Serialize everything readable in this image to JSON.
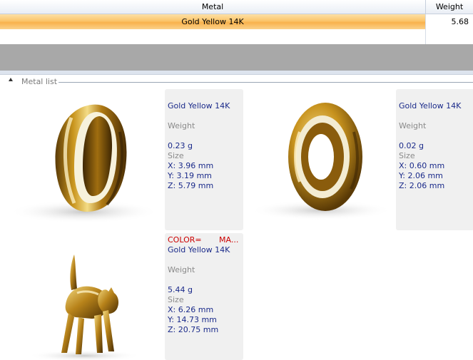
{
  "grid": {
    "headers": {
      "metal": "Metal",
      "weight": "Weight"
    },
    "rows": [
      {
        "metal": "Gold Yellow 14K",
        "weight": "5.68"
      }
    ]
  },
  "metal_list": {
    "title": "Metal list",
    "items": [
      {
        "color_label": "",
        "color_value": "",
        "metal": "Gold Yellow 14K",
        "weight_label": "Weight",
        "weight": "0.23 g",
        "size_label": "Size",
        "x": "X: 3.96 mm",
        "y": "Y: 3.19 mm",
        "z": "Z: 5.79 mm",
        "thumbnail": "teardrop-ring"
      },
      {
        "color_label": "",
        "color_value": "",
        "metal": "Gold Yellow 14K",
        "weight_label": "Weight",
        "weight": "0.02 g",
        "size_label": "Size",
        "x": "X: 0.60 mm",
        "y": "Y: 2.06 mm",
        "z": "Z: 2.06 mm",
        "thumbnail": "round-ring"
      },
      {
        "color_label": "COLOR=",
        "color_value": "MA...",
        "metal": "Gold Yellow 14K",
        "weight_label": "Weight",
        "weight": "5.44 g",
        "size_label": "Size",
        "x": "X: 6.26 mm",
        "y": "Y: 14.73 mm",
        "z": "Z: 20.75 mm",
        "thumbnail": "cat-figurine"
      }
    ]
  },
  "colors": {
    "selection": "#fbc46a",
    "value_text": "#1a2a8a",
    "label_text": "#8a8a8a",
    "warning_text": "#cc0000"
  }
}
